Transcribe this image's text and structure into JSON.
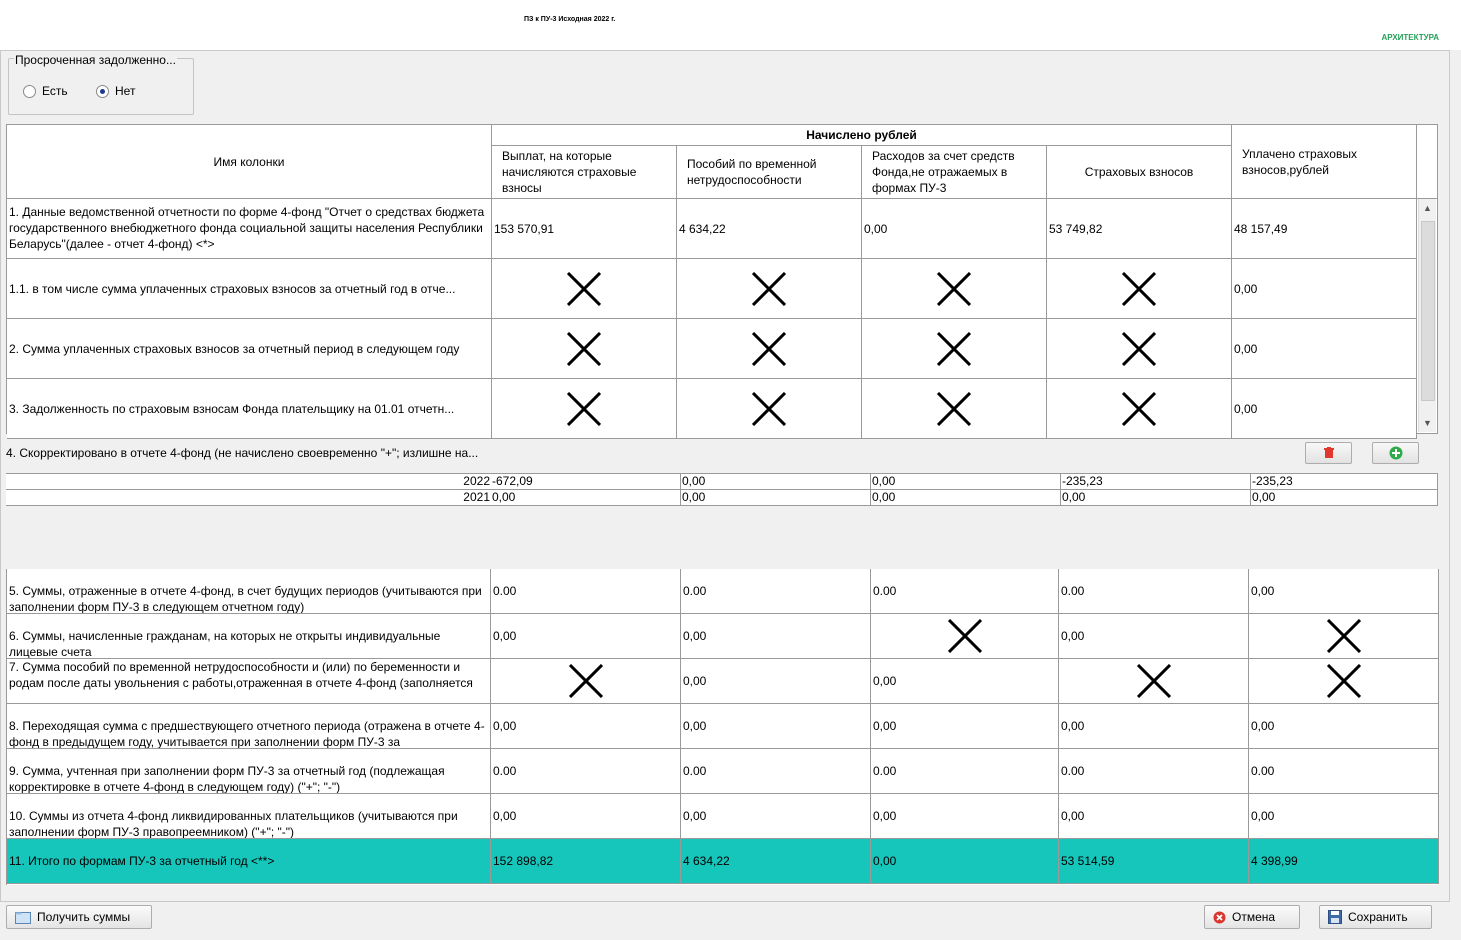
{
  "header": {
    "doc_title": "ПЗ к ПУ-3 Исходная 2022 г.",
    "corner_label": "АРХИТЕКТУРА"
  },
  "overdue": {
    "title": "Просроченная задолженно...",
    "options": [
      {
        "label": "Есть",
        "selected": false
      },
      {
        "label": "Нет",
        "selected": true
      }
    ]
  },
  "table1": {
    "col_name_header": "Имя колонки",
    "group_header": "Начислено рублей",
    "columns": [
      "Выплат, на которые начисляются страховые взносы",
      "Пособий по временной нетрудоспособности",
      "Расходов за счет средств Фонда,не отражаемых в формах ПУ-3",
      "Страховых взносов"
    ],
    "paid_header": "Уплачено страховых взносов,рублей",
    "rows": [
      {
        "label": "1. Данные ведомственной отчетности по форме 4-фонд \"Отчет о средствах бюджета государственного внебюджетного фонда социальной защиты населения Республики Беларусь\"(далее - отчет 4-фонд) <*>",
        "values": [
          "153 570,91",
          "4 634,22",
          "0,00",
          "53 749,82",
          "48 157,49"
        ]
      },
      {
        "label": "1.1. в том числе сумма уплаченных страховых взносов за отчетный год в отче...",
        "values": [
          "x",
          "x",
          "x",
          "x",
          "0,00"
        ]
      },
      {
        "label": "2. Сумма уплаченных страховых взносов за отчетный период в следующем году",
        "values": [
          "x",
          "x",
          "x",
          "x",
          "0,00"
        ]
      },
      {
        "label": "3. Задолженность по страховым взносам Фонда плательщику на 01.01 отчетн...",
        "values": [
          "x",
          "x",
          "x",
          "x",
          "0,00"
        ]
      }
    ]
  },
  "section4": {
    "label": "4. Скорректировано в отчете 4-фонд (не начислено своевременно \"+\"; излишне на...",
    "delete_icon": "trash-icon",
    "add_icon": "plus-circle-icon",
    "rows": [
      {
        "year": "2022",
        "values": [
          "-672,09",
          "0,00",
          "0,00",
          "-235,23",
          "-235,23"
        ]
      },
      {
        "year": "2021",
        "values": [
          "0,00",
          "0,00",
          "0,00",
          "0,00",
          "0,00"
        ]
      }
    ]
  },
  "table2": {
    "rows": [
      {
        "label": "5. Суммы, отраженные в отчете 4-фонд, в счет будущих периодов (учитываются при заполнении форм ПУ-3 в следующем отчетном году)",
        "values": [
          "0.00",
          "0.00",
          "0.00",
          "0.00",
          "0,00"
        ]
      },
      {
        "label": "6. Суммы, начисленные гражданам, на которых не открыты индивидуальные лицевые счета",
        "values": [
          "0,00",
          "0,00",
          "x",
          "0,00",
          "x"
        ]
      },
      {
        "label": "7. Сумма пособий по временной нетрудоспособности и (или) по беременности и родам после даты увольнения с работы,отраженная в отчете 4-фонд (заполняется",
        "values": [
          "x",
          "0,00",
          "0,00",
          "x",
          "x"
        ]
      },
      {
        "label": "8. Переходящая сумма с предшествующего отчетного периода (отражена в отчете 4-фонд в предыдущем году, учитывается при заполнении форм ПУ-3 за",
        "values": [
          "0,00",
          "0,00",
          "0,00",
          "0,00",
          "0,00"
        ]
      },
      {
        "label": "9. Сумма, учтенная при заполнении форм ПУ-3 за отчетный год (подлежащая корректировке в отчете 4-фонд в следующем году) (\"+\"; \"-\")",
        "values": [
          "0.00",
          "0.00",
          "0.00",
          "0.00",
          "0.00"
        ]
      },
      {
        "label": "10. Суммы из отчета 4-фонд ликвидированных плательщиков (учитываются при заполнении форм ПУ-3 правопреемником) (\"+\"; \"-\")",
        "values": [
          "0,00",
          "0,00",
          "0,00",
          "0,00",
          "0,00"
        ]
      }
    ],
    "total": {
      "label": "11. Итого по формам ПУ-3 за отчетный год <**>",
      "values": [
        "152 898,82",
        "4 634,22",
        "0,00",
        "53 514,59",
        "4 398,99"
      ]
    },
    "total_color": "#17c6bb"
  },
  "buttons": {
    "get_sums": {
      "label": "Получить суммы",
      "icon": "folder-icon"
    },
    "cancel": {
      "label": "Отмена",
      "icon": "cancel-icon"
    },
    "save": {
      "label": "Сохранить",
      "icon": "save-icon"
    }
  }
}
